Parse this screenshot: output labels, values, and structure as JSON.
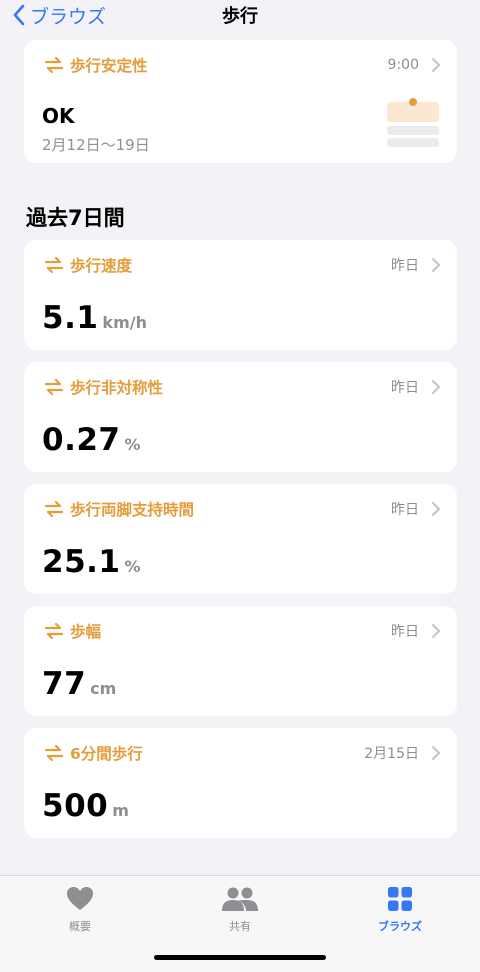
{
  "nav": {
    "back_label": "ブラウズ",
    "title": "歩行"
  },
  "stability": {
    "title": "歩行安定性",
    "time": "9:00",
    "status": "OK",
    "dates": "2月12日〜19日"
  },
  "section_title": "過去7日間",
  "metrics": [
    {
      "title": "歩行速度",
      "meta": "昨日",
      "value": "5.1",
      "unit": "km/h"
    },
    {
      "title": "歩行非対称性",
      "meta": "昨日",
      "value": "0.27",
      "unit": "%"
    },
    {
      "title": "歩行両脚支持時間",
      "meta": "昨日",
      "value": "25.1",
      "unit": "%"
    },
    {
      "title": "歩幅",
      "meta": "昨日",
      "value": "77",
      "unit": "cm"
    },
    {
      "title": "6分間歩行",
      "meta": "2月15日",
      "value": "500",
      "unit": "m"
    }
  ],
  "tabs": [
    {
      "label": "概要",
      "icon": "heart-icon",
      "active": false
    },
    {
      "label": "共有",
      "icon": "people-icon",
      "active": false
    },
    {
      "label": "ブラウズ",
      "icon": "grid-icon",
      "active": true
    }
  ],
  "colors": {
    "accent": "#e59c3b",
    "tint": "#3478f6",
    "background": "#f2f2f7"
  }
}
